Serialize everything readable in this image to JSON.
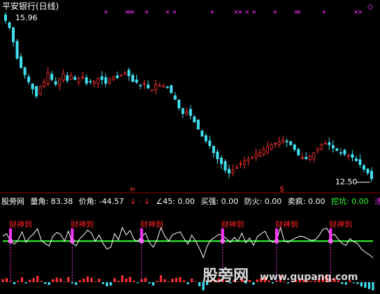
{
  "header": {
    "stock_title": "平安银行(日线)",
    "top_right_marker": "◇"
  },
  "price_panel": {
    "max_label": "15.96",
    "min_label": "12.50",
    "arrow_marker": "⊳",
    "dollar_marker": "$",
    "cross_marker": "×"
  },
  "indicator_bar": {
    "items": [
      {
        "text": "股旁网",
        "color": "#ffffff"
      },
      {
        "text": "量角: 83.38",
        "color": "#ffffff"
      },
      {
        "text": "价角: -44.57",
        "color": "#ffffff"
      },
      {
        "text": "↓ · ↓",
        "color": "#ff3333"
      },
      {
        "text": "∠45: 0.00",
        "color": "#ffffff"
      },
      {
        "text": "买强: 0.00",
        "color": "#ffffff"
      },
      {
        "text": "防火: 0.00",
        "color": "#ffffff"
      },
      {
        "text": "卖疯: 0.00",
        "color": "#ffffff"
      },
      {
        "text": "挖坑: 0.00",
        "color": "#33ff33"
      },
      {
        "text": "涉",
        "color": "#ff33ff"
      }
    ]
  },
  "signal_label": "财神到",
  "watermark": {
    "cn": "股旁网",
    "url": "www.gupang.com"
  },
  "colors": {
    "up": "#ff3030",
    "down": "#40e0f0",
    "magenta": "#ff33ff",
    "green_line": "#33ff33",
    "white": "#ffffff",
    "red_text": "#ff2020"
  },
  "chart_data": [
    {
      "type": "candlestick",
      "title": "平安银行(日线)",
      "ylim": [
        12.5,
        15.96
      ],
      "annotations": [
        "15.96",
        "12.50"
      ],
      "close": [
        15.85,
        15.7,
        15.4,
        15.05,
        14.85,
        14.7,
        14.55,
        14.4,
        14.25,
        14.45,
        14.55,
        14.75,
        14.6,
        14.5,
        14.62,
        14.72,
        14.58,
        14.68,
        14.6,
        14.62,
        14.65,
        14.52,
        14.55,
        14.56,
        14.62,
        14.6,
        14.52,
        14.62,
        14.66,
        14.64,
        14.7,
        14.74,
        14.68,
        14.56,
        14.54,
        14.48,
        14.52,
        14.42,
        14.38,
        14.5,
        14.48,
        14.46,
        14.44,
        14.32,
        14.18,
        14.0,
        13.88,
        13.92,
        13.84,
        13.7,
        13.55,
        13.4,
        13.3,
        13.2,
        13.05,
        12.92,
        12.82,
        12.68,
        12.62,
        12.68,
        12.75,
        12.82,
        12.88,
        12.92,
        12.96,
        13.02,
        13.05,
        13.12,
        13.18,
        13.22,
        13.25,
        13.28,
        13.32,
        13.28,
        13.22,
        13.12,
        13.0,
        12.95,
        12.92,
        12.98,
        13.05,
        13.15,
        13.22,
        13.25,
        13.22,
        13.15,
        13.1,
        13.05,
        13.02,
        13.0,
        12.95,
        12.88,
        12.8,
        12.7,
        12.62,
        12.5
      ]
    },
    {
      "type": "line",
      "series": [
        {
          "name": "",
          "values": [
            0.68,
            0.72,
            0.6,
            0.55,
            0.62,
            0.75,
            0.58,
            0.66,
            0.72,
            0.8,
            0.61,
            0.56,
            0.52,
            0.68,
            0.74,
            0.71,
            0.6,
            0.76,
            0.58,
            0.52,
            0.64,
            0.7,
            0.78,
            0.73,
            0.6,
            0.7,
            0.56,
            0.47,
            0.5,
            0.72,
            0.62,
            0.82,
            0.7,
            0.77,
            0.63,
            0.59,
            0.68,
            0.73,
            0.58,
            0.5,
            0.62,
            0.82,
            0.68,
            0.6,
            0.7,
            0.73,
            0.75,
            0.64,
            0.55,
            0.7,
            0.6,
            0.48,
            0.33,
            0.52,
            0.62,
            0.66,
            0.71,
            0.69,
            0.64,
            0.58,
            0.66,
            0.6,
            0.73,
            0.57,
            0.65,
            0.53,
            0.67,
            0.72,
            0.76,
            0.63,
            0.58,
            0.62,
            0.82,
            0.6,
            0.58,
            0.62,
            0.65,
            0.68,
            0.67,
            0.64,
            0.61,
            0.62,
            0.69,
            0.79,
            0.81,
            0.69,
            0.71,
            0.63,
            0.56,
            0.53,
            0.64,
            0.59,
            0.56,
            0.47,
            0.42,
            0.38,
            0.33
          ]
        }
      ],
      "baseline": 0.6,
      "signals": [
        2,
        18,
        36,
        57,
        71,
        85
      ]
    }
  ]
}
